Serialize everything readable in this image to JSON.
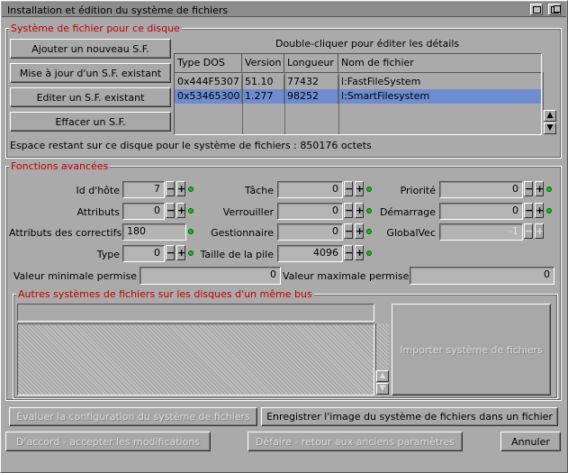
{
  "window": {
    "title": "Installation et édition du système de fichiers"
  },
  "fs_group": {
    "label": "Système de fichier pour ce disque",
    "buttons": {
      "add": "Ajouter un nouveau S.F.",
      "update": "Mise à jour d'un S.F. existant",
      "edit": "Editer un S.F. existant",
      "delete": "Effacer un S.F."
    },
    "list_hint": "Double-cliquer pour éditer les détails",
    "columns": [
      "Type DOS",
      "Version",
      "Longueur",
      "Nom de fichier"
    ],
    "rows": [
      {
        "dostype": "0x444F5307",
        "version": "51.10",
        "length": "77432",
        "filename": "l:FastFileSystem",
        "selected": false
      },
      {
        "dostype": "0x53465300",
        "version": "1.277",
        "length": "98252",
        "filename": "l:SmartFilesystem",
        "selected": true
      }
    ],
    "space_text": "Espace restant sur ce disque pour le système de fichiers : 850176 octets"
  },
  "adv": {
    "label": "Fonctions avancées",
    "host_id": {
      "label": "Id d'hôte",
      "value": "7"
    },
    "attributes": {
      "label": "Attributs",
      "value": "0"
    },
    "patch_attributes": {
      "label": "Attributs des correctifs",
      "value": "180"
    },
    "type": {
      "label": "Type",
      "value": "0"
    },
    "task": {
      "label": "Tâche",
      "value": "0"
    },
    "lock": {
      "label": "Verrouiller",
      "value": "0"
    },
    "handler": {
      "label": "Gestionnaire",
      "value": "0"
    },
    "stack": {
      "label": "Taille de la pile",
      "value": "4096"
    },
    "priority": {
      "label": "Priorité",
      "value": "0"
    },
    "startup": {
      "label": "Démarrage",
      "value": "0"
    },
    "globvec": {
      "label": "GlobalVec",
      "value": "-1"
    },
    "min_label": "Valeur minimale permise",
    "min_value": "0",
    "max_label": "Valeur maximale permise",
    "max_value": "0"
  },
  "other": {
    "label": "Autres systèmes de fichiers sur les disques d'un même bus",
    "import_button": "Importer système de fichiers"
  },
  "bottom": {
    "evaluate": "Évaluer la configuration du système de fichiers",
    "save_image": "Enregistrer l'image du système de fichiers dans un fichier",
    "ok": "D'accord - accepter les modifications",
    "revert": "Défaire - retour aux anciens paramètres",
    "cancel": "Annuler"
  },
  "colors": {
    "background": "#aaaaaa",
    "selection": "#6d8dd0",
    "group_label": "#c00000",
    "led": "#00cc00"
  },
  "icons": [
    "zoom-icon",
    "depth-icon",
    "plus-icon",
    "minus-icon",
    "scroll-up-icon",
    "scroll-down-icon",
    "status-led-icon"
  ]
}
